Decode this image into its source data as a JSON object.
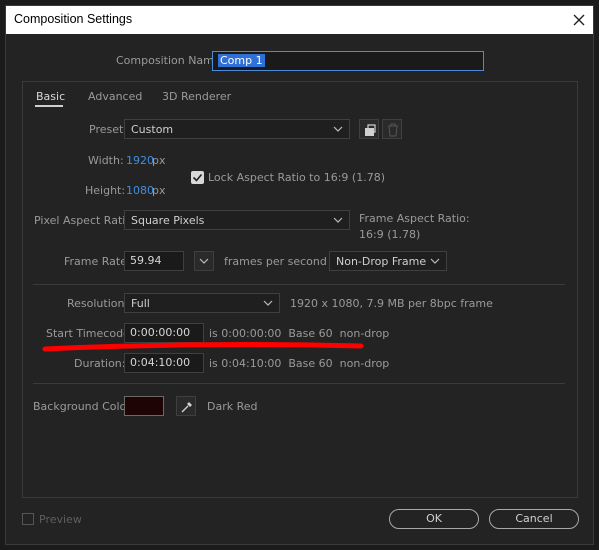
{
  "window": {
    "title": "Composition Settings"
  },
  "comp_name": {
    "label": "Composition Name:",
    "value": "Comp 1"
  },
  "tabs": [
    {
      "label": "Basic",
      "active": true
    },
    {
      "label": "Advanced",
      "active": false
    },
    {
      "label": "3D Renderer",
      "active": false
    }
  ],
  "preset": {
    "label": "Preset:",
    "value": "Custom"
  },
  "width": {
    "label": "Width:",
    "value": "1920",
    "unit": "px"
  },
  "height": {
    "label": "Height:",
    "value": "1080",
    "unit": "px"
  },
  "lock_aspect": {
    "label": "Lock Aspect Ratio to 16:9 (1.78)",
    "checked": true
  },
  "pixel_aspect": {
    "label": "Pixel Aspect Ratio:",
    "value": "Square Pixels"
  },
  "frame_aspect": {
    "label": "Frame Aspect Ratio:",
    "value": "16:9 (1.78)"
  },
  "frame_rate": {
    "label": "Frame Rate:",
    "value": "59.94",
    "unit": "frames per second",
    "drop_mode": "Non-Drop Frame"
  },
  "resolution": {
    "label": "Resolution:",
    "value": "Full",
    "info": "1920 x 1080, 7.9 MB per 8bpc frame"
  },
  "start_timecode": {
    "label": "Start Timecode:",
    "value": "0:00:00:00",
    "info": "is 0:00:00:00  Base 60  non-drop"
  },
  "duration": {
    "label": "Duration:",
    "value": "0:04:10:00",
    "info": "is 0:04:10:00  Base 60  non-drop"
  },
  "background_color": {
    "label": "Background Color:",
    "name": "Dark Red",
    "swatch": "#1e0404"
  },
  "footer": {
    "preview_label": "Preview",
    "ok_label": "OK",
    "cancel_label": "Cancel"
  },
  "colors": {
    "accent_blue": "#3f8fe0",
    "annotation_red": "#ff0000",
    "name_field_border": "#4a8ad8"
  },
  "icons": [
    "close-icon",
    "chevron-down-icon",
    "save-preset-icon",
    "trash-icon",
    "checkbox-checked-icon",
    "eyedropper-icon"
  ]
}
